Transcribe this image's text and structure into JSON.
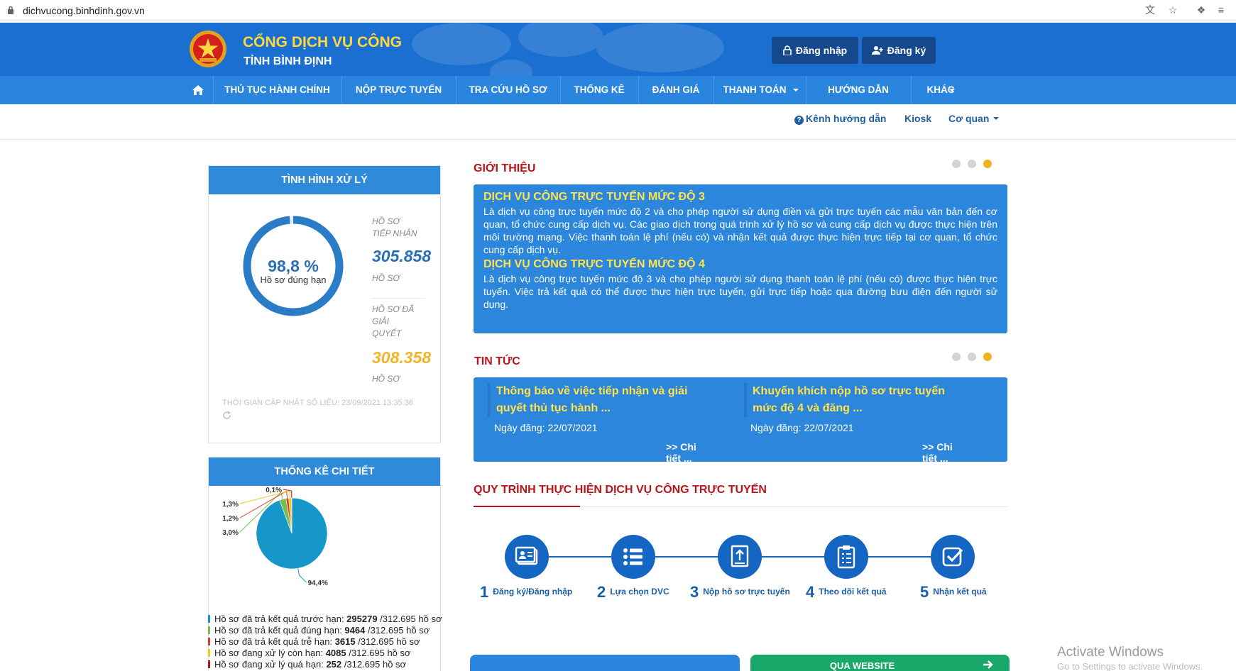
{
  "browser": {
    "url": "dichvucong.binhdinh.gov.vn"
  },
  "header": {
    "title": "CỔNG DỊCH VỤ CÔNG",
    "subtitle": "TỈNH BÌNH ĐỊNH",
    "login_label": "Đăng nhập",
    "register_label": "Đăng ký"
  },
  "nav": {
    "items": [
      {
        "label": "THỦ TỤC HÀNH CHÍNH"
      },
      {
        "label": "NỘP TRỰC TUYẾN"
      },
      {
        "label": "TRA CỨU HỒ SƠ"
      },
      {
        "label": "THỐNG KÊ"
      },
      {
        "label": "ĐÁNH GIÁ"
      },
      {
        "label": "THANH TOÁN"
      },
      {
        "label": "HƯỚNG DẪN"
      },
      {
        "label": "KHÁC"
      }
    ]
  },
  "subnav": {
    "guide": "Kênh hướng dẫn",
    "kiosk": "Kiosk",
    "agency": "Cơ quan"
  },
  "status": {
    "title": "TÌNH HÌNH XỬ LÝ",
    "percent": "98,8 %",
    "percent_value": 98.8,
    "percent_label": "Hồ sơ đúng hạn",
    "received_label_1": "HỒ SƠ",
    "received_label_2": "TIẾP NHẬN",
    "received_value": "305.858",
    "unit": "HỒ SƠ",
    "resolved_label_1": "HỒ SƠ ĐÃ",
    "resolved_label_2": "GIẢI",
    "resolved_label_3": "QUYẾT",
    "resolved_value": "308.358",
    "updated": "THỜI GIAN CẬP NHẬT SỐ LIỆU: 23/09/2021 13:35:36"
  },
  "stats": {
    "title": "THỐNG KÊ CHI TIẾT",
    "legend": [
      {
        "text": "Hồ sơ đã trả kết quả trước hạn: ",
        "value": "295279",
        "total": " /312.695 hồ sơ",
        "color": "#1597c9"
      },
      {
        "text": "Hồ sơ đã trả kết quả đúng hạn: ",
        "value": "9464",
        "total": " /312.695 hồ sơ",
        "color": "#77c04b"
      },
      {
        "text": "Hồ sơ đã trả kết quả trễ hạn: ",
        "value": "3615",
        "total": " /312.695 hồ sơ",
        "color": "#e2382c"
      },
      {
        "text": "Hồ sơ đang xử lý còn hạn: ",
        "value": "4085",
        "total": " /312.695 hồ sơ",
        "color": "#f2c81f"
      },
      {
        "text": "Hồ sơ đang xử lý quá hạn: ",
        "value": "252",
        "total": " /312.695 hồ sơ",
        "color": "#b01620"
      }
    ]
  },
  "chart_data": {
    "type": "pie",
    "categories": [
      "Hồ sơ đã trả kết quả trước hạn",
      "Hồ sơ đã trả kết quả đúng hạn",
      "Hồ sơ đã trả kết quả trễ hạn",
      "Hồ sơ đang xử lý còn hạn",
      "Hồ sơ đang xử lý quá hạn"
    ],
    "values": [
      94.4,
      3.0,
      1.2,
      1.3,
      0.1
    ],
    "labels": [
      "94,4%",
      "3,0%",
      "1,2%",
      "1,3%",
      "0,1%"
    ],
    "colors": [
      "#1597c9",
      "#77c04b",
      "#e2382c",
      "#f2c81f",
      "#b01620"
    ]
  },
  "intro": {
    "title": "GIỚI THIỆU",
    "h1": "DỊCH VỤ CÔNG TRỰC TUYẾN MỨC ĐỘ 3",
    "p1": "Là dịch vụ công trực tuyến mức độ 2 và cho phép người sử dụng điền và gửi trực tuyến các mẫu văn bản đến cơ quan, tổ chức cung cấp dịch vụ. Các giao dịch trong quá trình xử lý hồ sơ và cung cấp dịch vụ được thực hiện trên môi trường mạng. Việc thanh toán lệ phí (nếu có) và nhận kết quả được thực hiện trực tiếp tại cơ quan, tổ chức cung cấp dịch vụ.",
    "h2": "DỊCH VỤ CÔNG TRỰC TUYẾN MỨC ĐỘ 4",
    "p2": "Là dịch vụ công trực tuyến mức độ 3 và cho phép người sử dụng thanh toán lệ phí (nếu có) được thực hiện trực tuyến. Việc trả kết quả có thể được thực hiện trực tuyến, gửi trực tiếp hoặc qua đường bưu điện đến người sử dụng."
  },
  "news": {
    "title": "TIN TỨC",
    "items": [
      {
        "title": "Thông báo về việc tiếp nhận và giải quyết thủ tục hành ...",
        "date": "Ngày đăng: 22/07/2021",
        "more": ">> Chi tiết ..."
      },
      {
        "title": "Khuyến khích nộp hồ sơ trực tuyến mức độ 4 và đăng ...",
        "date": "Ngày đăng: 22/07/2021",
        "more": ">> Chi tiết ..."
      }
    ]
  },
  "process": {
    "title": "QUY TRÌNH THỰC HIỆN DỊCH VỤ CÔNG TRỰC TUYẾN",
    "steps": [
      {
        "n": "1",
        "label": "Đăng ký/Đăng nhập"
      },
      {
        "n": "2",
        "label": "Lựa chọn DVC"
      },
      {
        "n": "3",
        "label": "Nộp hồ sơ trực tuyến"
      },
      {
        "n": "4",
        "label": "Theo dõi kết quả"
      },
      {
        "n": "5",
        "label": "Nhận kết quả"
      }
    ]
  },
  "bottom": {
    "website": "QUA WEBSITE"
  },
  "watermark": {
    "line1": "Activate Windows",
    "line2": "Go to Settings to activate Windows."
  }
}
